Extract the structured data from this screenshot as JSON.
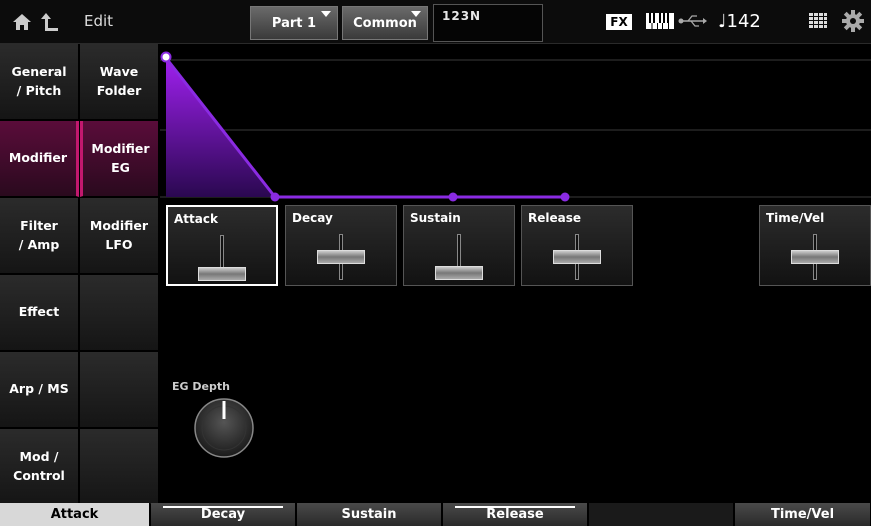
{
  "header": {
    "mode_title": "Edit",
    "part_tab": "Part 1",
    "common_tab": "Common",
    "performance_name": "123N",
    "fx_badge": "FX",
    "tempo": "♩142"
  },
  "nav_left": [
    {
      "label": "General\n/ Pitch",
      "active": false
    },
    {
      "label": "Modifier",
      "active": true
    },
    {
      "label": "Filter\n/ Amp",
      "active": false
    },
    {
      "label": "Effect",
      "active": false
    },
    {
      "label": "Arp / MS",
      "active": false
    },
    {
      "label": "Mod /\nControl",
      "active": false
    }
  ],
  "nav_sub": [
    {
      "label": "Wave\nFolder",
      "active": false
    },
    {
      "label": "Modifier EG",
      "active": true
    },
    {
      "label": "Modifier\nLFO",
      "active": false
    }
  ],
  "params": {
    "attack": {
      "label": "Attack",
      "level": 0.0
    },
    "decay": {
      "label": "Decay",
      "level": 0.5
    },
    "sustain": {
      "label": "Sustain",
      "level": 0.0
    },
    "release": {
      "label": "Release",
      "level": 0.5
    },
    "time_vel": {
      "label": "Time/Vel",
      "level": 0.5
    }
  },
  "eg_depth": {
    "label": "EG Depth",
    "value": 0
  },
  "function_bar": {
    "attack": "Attack",
    "decay": "Decay",
    "sustain": "Sustain",
    "release": "Release",
    "time_vel": "Time/Vel"
  },
  "colors": {
    "accent": "#c2186e",
    "envelope": "#8a2be2"
  }
}
